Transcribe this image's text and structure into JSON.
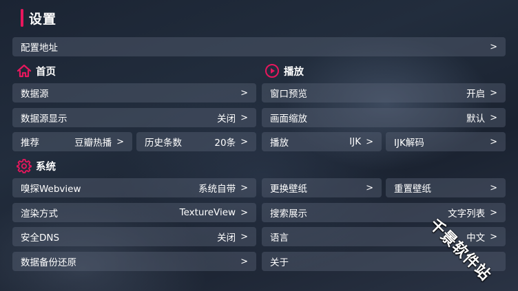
{
  "header": {
    "title": "设置",
    "accent_color": "#e8175d"
  },
  "config": {
    "label": "配置地址",
    "chevron": ">"
  },
  "sections": {
    "home": {
      "title": "首页",
      "icon": "home-icon"
    },
    "play": {
      "title": "播放",
      "icon": "play-circle-icon"
    },
    "system": {
      "title": "系统",
      "icon": "gear-icon"
    }
  },
  "home": {
    "datasource": {
      "label": "数据源",
      "chevron": ">"
    },
    "datasource_display": {
      "label": "数据源显示",
      "value": "关闭",
      "chevron": ">"
    },
    "recommend": {
      "label": "推荐",
      "value": "豆瓣热播",
      "chevron": ">"
    },
    "history": {
      "label": "历史条数",
      "value": "20条",
      "chevron": ">"
    }
  },
  "play": {
    "window_preview": {
      "label": "窗口预览",
      "value": "开启",
      "chevron": ">"
    },
    "scale": {
      "label": "画面缩放",
      "value": "默认",
      "chevron": ">"
    },
    "player": {
      "label": "播放",
      "value": "IJK",
      "chevron": ">"
    },
    "decoder": {
      "label": "IJK解码",
      "chevron": ">"
    }
  },
  "system": {
    "sniff": {
      "label": "嗅探Webview",
      "value": "系统自带",
      "chevron": ">"
    },
    "wallpaper_change": {
      "label": "更换壁纸",
      "chevron": ">"
    },
    "wallpaper_reset": {
      "label": "重置壁纸",
      "chevron": ">"
    },
    "render": {
      "label": "渲染方式",
      "value": "TextureView",
      "chevron": ">"
    },
    "search_display": {
      "label": "搜索展示",
      "value": "文字列表",
      "chevron": ">"
    },
    "dns": {
      "label": "安全DNS",
      "value": "关闭",
      "chevron": ">"
    },
    "language": {
      "label": "语言",
      "value": "中文",
      "chevron": ">"
    },
    "backup": {
      "label": "数据备份还原",
      "chevron": ">"
    },
    "about": {
      "label": "关于"
    }
  },
  "watermark": {
    "text": "千景软件站"
  }
}
